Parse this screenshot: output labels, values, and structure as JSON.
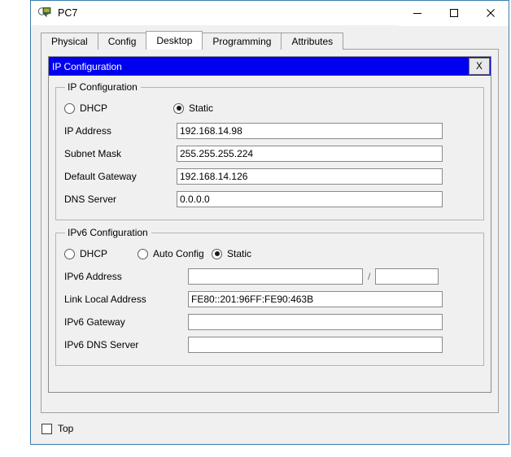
{
  "window": {
    "title": "PC7",
    "icon": "packet-tracer-pc-icon",
    "controls": {
      "minimize": "—",
      "maximize": "☐",
      "close": "✕"
    },
    "border_color": "#3c7fb1"
  },
  "tabs": [
    {
      "label": "Physical",
      "active": false
    },
    {
      "label": "Config",
      "active": false
    },
    {
      "label": "Desktop",
      "active": true
    },
    {
      "label": "Programming",
      "active": false
    },
    {
      "label": "Attributes",
      "active": false
    }
  ],
  "dialog": {
    "title": "IP Configuration",
    "title_bar_color": "#0000ee",
    "close_label": "X",
    "ipv4": {
      "legend": "IP Configuration",
      "modes": [
        {
          "label": "DHCP",
          "selected": false
        },
        {
          "label": "Static",
          "selected": true
        }
      ],
      "fields": [
        {
          "label": "IP Address",
          "value": "192.168.14.98"
        },
        {
          "label": "Subnet Mask",
          "value": "255.255.255.224"
        },
        {
          "label": "Default Gateway",
          "value": "192.168.14.126"
        },
        {
          "label": "DNS Server",
          "value": "0.0.0.0"
        }
      ]
    },
    "ipv6": {
      "legend": "IPv6 Configuration",
      "modes": [
        {
          "label": "DHCP",
          "selected": false
        },
        {
          "label": "Auto Config",
          "selected": false
        },
        {
          "label": "Static",
          "selected": true
        }
      ],
      "address_row": {
        "label": "IPv6 Address",
        "value": "",
        "separator": "/",
        "prefix_value": ""
      },
      "fields": [
        {
          "label": "Link Local Address",
          "value": "FE80::201:96FF:FE90:463B"
        },
        {
          "label": "IPv6 Gateway",
          "value": ""
        },
        {
          "label": "IPv6 DNS Server",
          "value": ""
        }
      ]
    }
  },
  "bottom": {
    "top_checkbox_label": "Top",
    "top_checkbox_checked": false
  }
}
